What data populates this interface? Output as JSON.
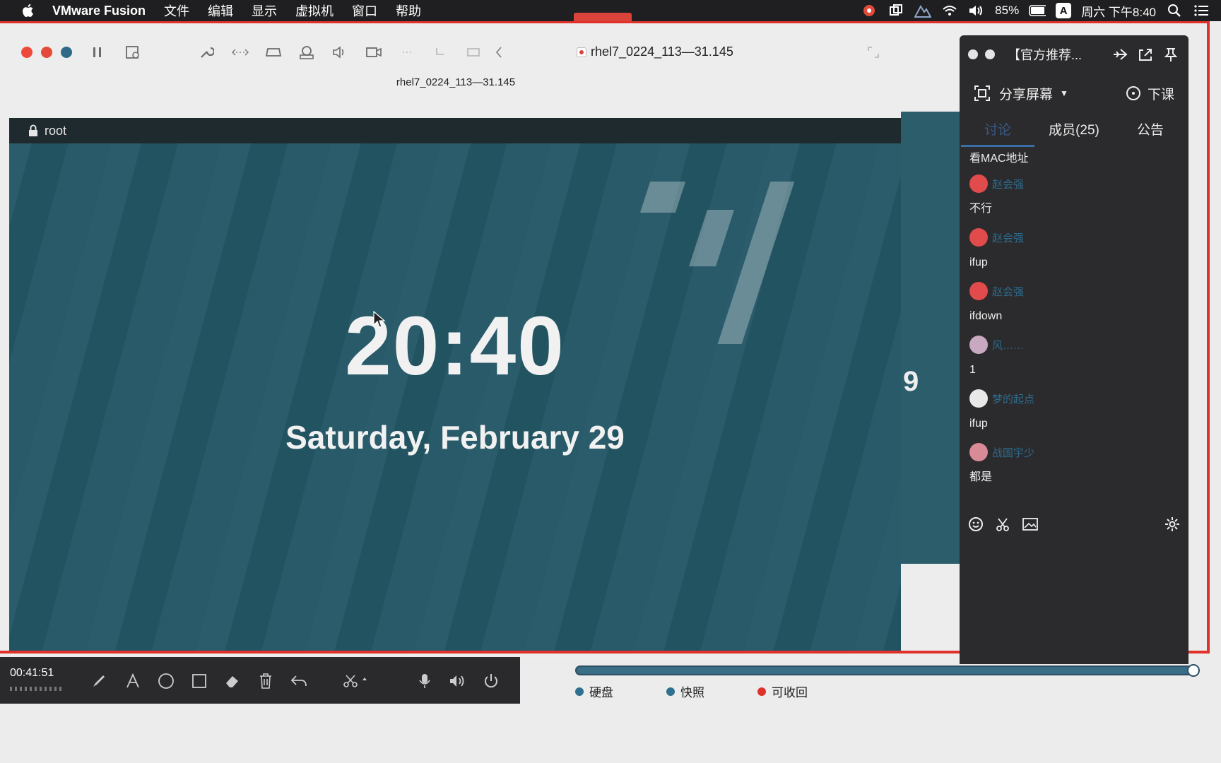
{
  "menubar": {
    "app_name": "VMware Fusion",
    "items": [
      "文件",
      "编辑",
      "显示",
      "虚拟机",
      "窗口",
      "帮助"
    ],
    "battery": "85%",
    "input_method": "A",
    "clock": "周六 下午8:40"
  },
  "vm": {
    "title": "rhel7_0224_113—31.145",
    "subtitle": "rhel7_0224_113—31.145",
    "guest": {
      "user": "root",
      "time": "20:40",
      "date": "Saturday, February 29",
      "behind_fragment": "9"
    }
  },
  "panel": {
    "title": "【官方推荐...",
    "share_screen": "分享屏幕",
    "end_class": "下课",
    "tabs": [
      "讨论",
      "成员(25)",
      "公告"
    ],
    "messages": [
      {
        "user": "",
        "text": "看MAC地址"
      },
      {
        "user": "赵会强",
        "text": "不行"
      },
      {
        "user": "赵会强",
        "text": "ifup"
      },
      {
        "user": "赵会强",
        "text": "ifdown"
      },
      {
        "user": "风……",
        "text": "1"
      },
      {
        "user": "梦的起点",
        "text": "ifup"
      },
      {
        "user": "战国宇少",
        "text": "都是"
      }
    ]
  },
  "recorder": {
    "timer": "00:41:51"
  },
  "legend": [
    {
      "label": "硬盘",
      "color": "#2f6f8f"
    },
    {
      "label": "快照",
      "color": "#2f6f8f"
    },
    {
      "label": "可收回",
      "color": "#e0322b"
    }
  ],
  "colors": {
    "accent_red": "#e0322b",
    "guest_bg": "#245766",
    "panel_bg": "#2b2b2d"
  }
}
